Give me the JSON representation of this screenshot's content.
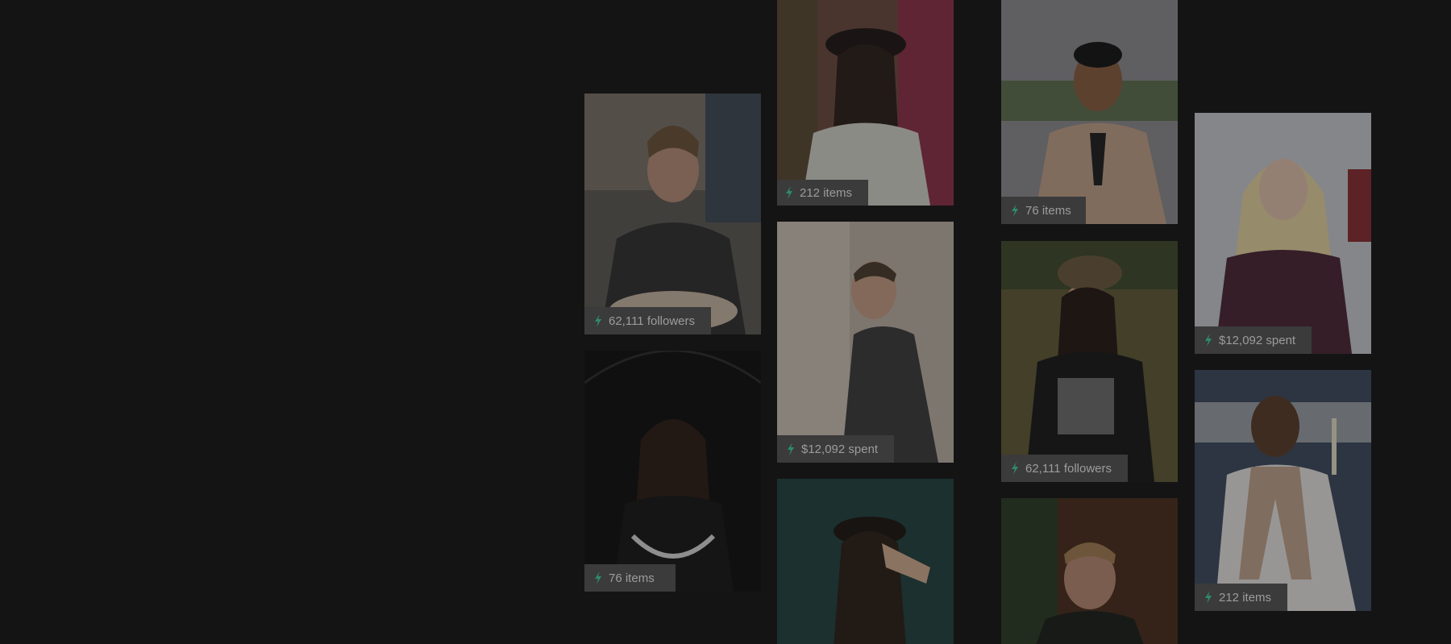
{
  "gallery": {
    "cards": [
      {
        "id": "c1",
        "stat": "62,111 followers",
        "icon": "bolt-icon"
      },
      {
        "id": "c2",
        "stat": "76 items",
        "icon": "bolt-icon"
      },
      {
        "id": "c3",
        "stat": "212 items",
        "icon": "bolt-icon"
      },
      {
        "id": "c4",
        "stat": "$12,092 spent",
        "icon": "bolt-icon"
      },
      {
        "id": "c5",
        "stat": "",
        "icon": "bolt-icon"
      },
      {
        "id": "c6",
        "stat": "76 items",
        "icon": "bolt-icon"
      },
      {
        "id": "c7",
        "stat": "62,111 followers",
        "icon": "bolt-icon"
      },
      {
        "id": "c8",
        "stat": "",
        "icon": "bolt-icon"
      },
      {
        "id": "c9",
        "stat": "$12,092 spent",
        "icon": "bolt-icon"
      },
      {
        "id": "c10",
        "stat": "212 items",
        "icon": "bolt-icon"
      }
    ]
  },
  "colors": {
    "background": "#141414",
    "badge": "#3b3b3b",
    "badge_text": "#9c9c9c",
    "bolt_accent": "#2f8a6c"
  }
}
